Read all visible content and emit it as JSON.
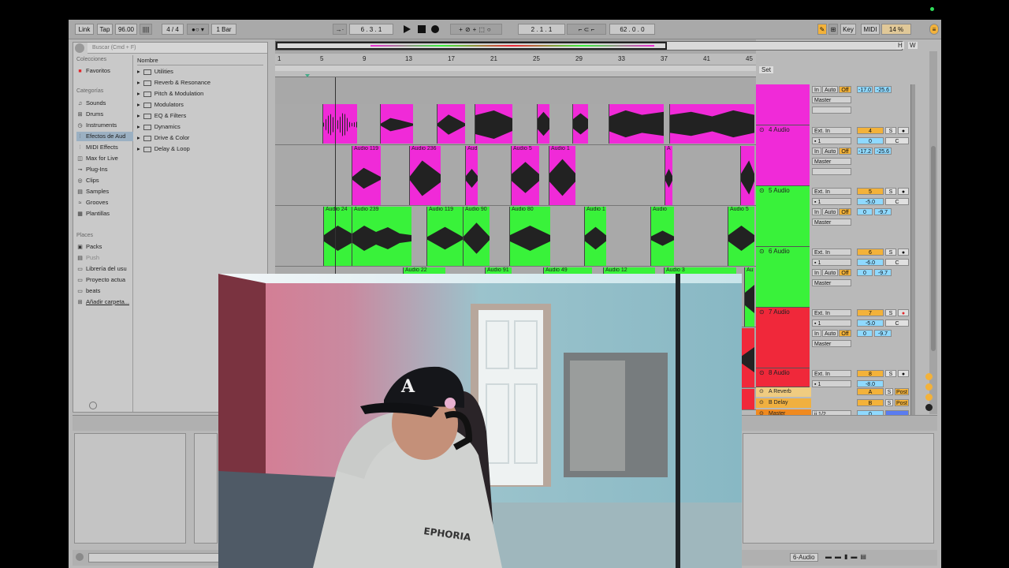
{
  "toolbar": {
    "link": "Link",
    "tap": "Tap",
    "tempo": "96.00",
    "meter": "4 / 4",
    "quantize": "1 Bar",
    "position": "6 .   3 .   1",
    "loop_start": "2 .   1 .   1",
    "loop_length": "62 .   0 .   0",
    "key": "Key",
    "midi": "MIDI",
    "cpu": "14 %"
  },
  "browser": {
    "search_placeholder": "Buscar (Cmd + F)",
    "collections_header": "Colecciones",
    "favorites": "Favoritos",
    "categories_header": "Categorías",
    "categories": [
      "Sounds",
      "Drums",
      "Instruments",
      "Efectos de Aud",
      "MIDI Effects",
      "Max for Live",
      "Plug-Ins",
      "Clips",
      "Samples",
      "Grooves",
      "Plantillas"
    ],
    "places_header": "Places",
    "places": [
      "Packs",
      "Push",
      "Librería del usu",
      "Proyecto actua",
      "beats",
      "Añadir carpeta..."
    ],
    "name_header": "Nombre",
    "folders": [
      "Utilities",
      "Reverb & Resonance",
      "Pitch & Modulation",
      "Modulators",
      "EQ & Filters",
      "Dynamics",
      "Drive & Color",
      "Delay & Loop"
    ]
  },
  "ruler": [
    "1",
    "5",
    "9",
    "13",
    "17",
    "21",
    "25",
    "29",
    "33",
    "37",
    "41",
    "45"
  ],
  "set_label": "Set",
  "tracks": [
    {
      "name": "4 Audio",
      "color": "#f02ad8",
      "clips": [
        "Audio 119",
        "Audio 236",
        "Aud",
        "Audio 5",
        "Audio 1",
        "A"
      ],
      "input": "Ext. In",
      "channel": "1",
      "num": "4",
      "vol": "-17.2",
      "pan": "-25.6",
      "output": "Master"
    },
    {
      "name": "5 Audio",
      "color": "#39f23a",
      "clips": [
        "Audio 24",
        "Audio 239",
        "Audio 119",
        "Audio 90",
        "Audio 80",
        "Audio 1",
        "Audio",
        "Audio 5"
      ],
      "input": "Ext. In",
      "channel": "1",
      "num": "5",
      "vol": "-5.0",
      "pan": "C",
      "send": "0",
      "send2": "-9.7",
      "output": "Master"
    },
    {
      "name": "6 Audio",
      "color": "#39f23a",
      "clips": [
        "Audio 22",
        "Audio 91",
        "Audio 49",
        "Audio 12",
        "Audio 3",
        "Au"
      ],
      "input": "Ext. In",
      "channel": "1",
      "num": "6",
      "vol": "-6.0",
      "pan": "C",
      "send": "0",
      "send2": "-9.7",
      "output": "Master"
    },
    {
      "name": "7 Audio",
      "color": "#f0283a",
      "input": "Ext. In",
      "channel": "1",
      "num": "7",
      "vol": "-5.0",
      "pan": "C",
      "send": "0",
      "send2": "-9.7",
      "output": "Master"
    },
    {
      "name": "8 Audio",
      "color": "#f0283a",
      "input": "Ext. In",
      "channel": "1",
      "num": "8",
      "vol": "-8.0"
    }
  ],
  "top_track": {
    "in": "In",
    "auto": "Auto",
    "off": "Off",
    "vol": "-17.0",
    "pan": "-25.6",
    "output": "Master"
  },
  "returns": [
    {
      "name": "A Reverb",
      "letter": "A",
      "post": "Post"
    },
    {
      "name": "B Delay",
      "letter": "B",
      "post": "Post"
    },
    {
      "name": "Master",
      "routing": "ii 1/2",
      "vol": "0"
    }
  ],
  "mixer": {
    "in": "In",
    "auto": "Auto",
    "off": "Off",
    "s": "S"
  },
  "status": {
    "selected_track": "6-Audio"
  },
  "webcam": {
    "hat_logo": "A",
    "hoodie_text": "EPHORIA"
  }
}
